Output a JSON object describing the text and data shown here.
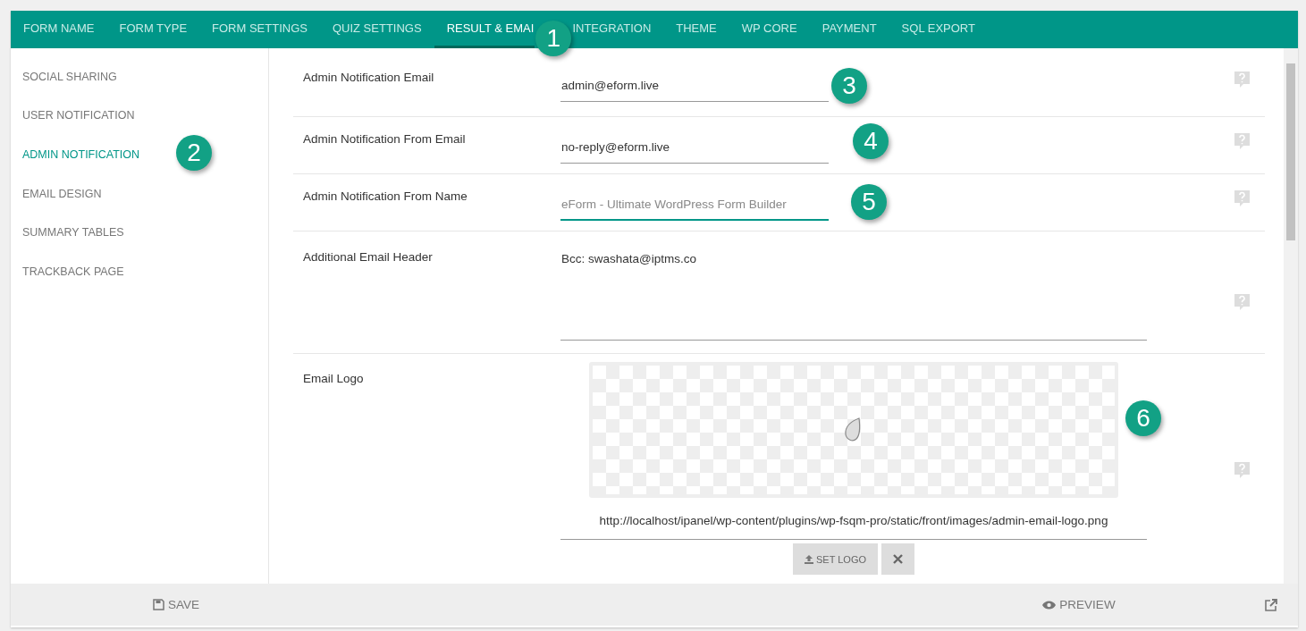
{
  "tabs": [
    {
      "label": "FORM NAME",
      "selected": false
    },
    {
      "label": "FORM TYPE",
      "selected": false
    },
    {
      "label": "FORM SETTINGS",
      "selected": false
    },
    {
      "label": "QUIZ SETTINGS",
      "selected": false
    },
    {
      "label": "RESULT & EMAI",
      "selected": true
    },
    {
      "label": "INTEGRATION",
      "selected": false
    },
    {
      "label": "THEME",
      "selected": false
    },
    {
      "label": "WP CORE",
      "selected": false
    },
    {
      "label": "PAYMENT",
      "selected": false
    },
    {
      "label": "SQL EXPORT",
      "selected": false
    }
  ],
  "sidebar": {
    "items": [
      {
        "label": "SOCIAL SHARING",
        "selected": false
      },
      {
        "label": "USER NOTIFICATION",
        "selected": false
      },
      {
        "label": "ADMIN NOTIFICATION",
        "selected": true
      },
      {
        "label": "EMAIL DESIGN",
        "selected": false
      },
      {
        "label": "SUMMARY TABLES",
        "selected": false
      },
      {
        "label": "TRACKBACK PAGE",
        "selected": false
      }
    ]
  },
  "settings": [
    {
      "kind": "input",
      "label": "Admin Notification Email",
      "value": "admin@eform.live",
      "focused": false
    },
    {
      "kind": "input",
      "label": "Admin Notification From Email",
      "value": "no-reply@eform.live",
      "focused": false
    },
    {
      "kind": "input",
      "label": "Admin Notification From Name",
      "placeholder": "eForm - Ultimate WordPress Form Builder",
      "focused": true
    },
    {
      "kind": "textarea",
      "label": "Additional Email Header",
      "value": "Bcc: swashata@iptms.co"
    },
    {
      "kind": "logo",
      "label": "Email Logo",
      "value": "http://localhost/ipanel/wp-content/plugins/wp-fsqm-pro/static/front/images/admin-email-logo.png",
      "set_button": "SET LOGO"
    }
  ],
  "footer": {
    "save": "SAVE",
    "preview": "PREVIEW"
  },
  "callouts": [
    "1",
    "2",
    "3",
    "4",
    "5",
    "6"
  ]
}
